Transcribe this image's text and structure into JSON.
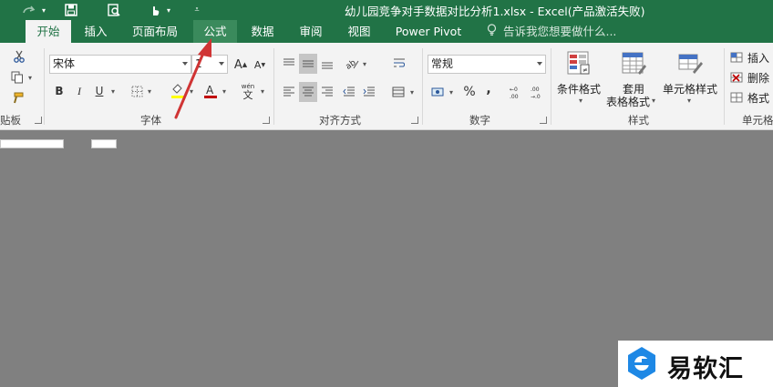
{
  "window": {
    "title": "幼儿园竞争对手数据对比分析1.xlsx - Excel(产品激活失败)"
  },
  "tabs": [
    {
      "label": "开始",
      "state": "active"
    },
    {
      "label": "插入",
      "state": "normal"
    },
    {
      "label": "页面布局",
      "state": "normal"
    },
    {
      "label": "公式",
      "state": "hover"
    },
    {
      "label": "数据",
      "state": "normal"
    },
    {
      "label": "审阅",
      "state": "normal"
    },
    {
      "label": "视图",
      "state": "normal"
    },
    {
      "label": "Power Pivot",
      "state": "normal"
    }
  ],
  "tell_me": {
    "text": "告诉我您想要做什么...",
    "icon": "lightbulb-icon"
  },
  "ribbon": {
    "clipboard": {
      "label": "贴板"
    },
    "font": {
      "label": "字体",
      "font_name": "宋体",
      "font_size": "1",
      "bold": "B",
      "italic": "I",
      "underline": "U",
      "wen_label": "wén",
      "wen_char": "文"
    },
    "alignment": {
      "label": "对齐方式"
    },
    "number": {
      "label": "数字",
      "format": "常规",
      "percent": "%",
      "comma": ","
    },
    "styles": {
      "label": "样式",
      "conditional_format": "条件格式",
      "table_format_1": "套用",
      "table_format_2": "表格格式",
      "cell_styles": "单元格样式"
    },
    "cells": {
      "label": "单元格",
      "insert": "插入",
      "delete": "删除",
      "format": "格式"
    }
  },
  "annotation": {
    "color": "#d03434"
  },
  "watermark": {
    "text": "易软汇"
  },
  "colors": {
    "excel_green": "#217346",
    "ribbon_bg": "#f3f3f3",
    "sheet_bg": "#808080"
  }
}
